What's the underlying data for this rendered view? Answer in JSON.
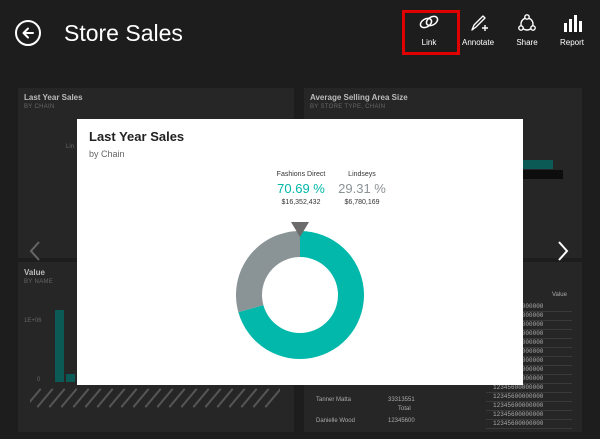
{
  "header": {
    "title": "Store Sales",
    "actions": [
      {
        "label": "Link",
        "icon": "link-icon"
      },
      {
        "label": "Annotate",
        "icon": "pen-icon"
      },
      {
        "label": "Share",
        "icon": "share-icon"
      },
      {
        "label": "Report",
        "icon": "report-icon"
      }
    ]
  },
  "background": {
    "tile1": {
      "title": "Last Year Sales",
      "subtitle": "BY CHAIN",
      "fragment": "Lin"
    },
    "tile2": {
      "title": "Average Selling Area Size",
      "subtitle": "BY STORE TYPE, CHAIN"
    },
    "tile3": {
      "title": "Value",
      "subtitle": "BY NAME",
      "axis_top": "1E+06",
      "axis_zero": "0"
    },
    "tile4": {
      "header": "Value",
      "rows": [
        "12345600000000",
        "12345600000000",
        "12345600000000",
        "12345600000000",
        "12345600000000",
        "12345600000000",
        "12345600000000",
        "12345600000000",
        "12345600000000",
        "12345600000000",
        "12345600000000",
        "12345600000000",
        "12345600000000",
        "12345600000000"
      ],
      "left_rows": [
        {
          "name": "",
          "num": "Total"
        },
        {
          "name": "Tanner Matta",
          "num": "33313551"
        },
        {
          "name": "",
          "num": "Total"
        },
        {
          "name": "Danielle Wood",
          "num": "12345600"
        }
      ]
    }
  },
  "modal": {
    "title": "Last Year Sales",
    "subtitle": "by Chain"
  },
  "colors": {
    "accent_teal": "#01b8aa",
    "gray": "#8a9396",
    "highlight_red": "#e00000"
  },
  "chart_data": {
    "type": "pie",
    "title": "Last Year Sales",
    "subtitle": "by Chain",
    "donut": true,
    "slices": [
      {
        "name": "Fashions Direct",
        "percent_label": "70.69 %",
        "value_label": "$16,352,432",
        "value": 16352432,
        "color": "#01b8aa"
      },
      {
        "name": "Lindseys",
        "percent_label": "29.31 %",
        "value_label": "$6,780,169",
        "value": 6780169,
        "color": "#8a9396"
      }
    ]
  }
}
